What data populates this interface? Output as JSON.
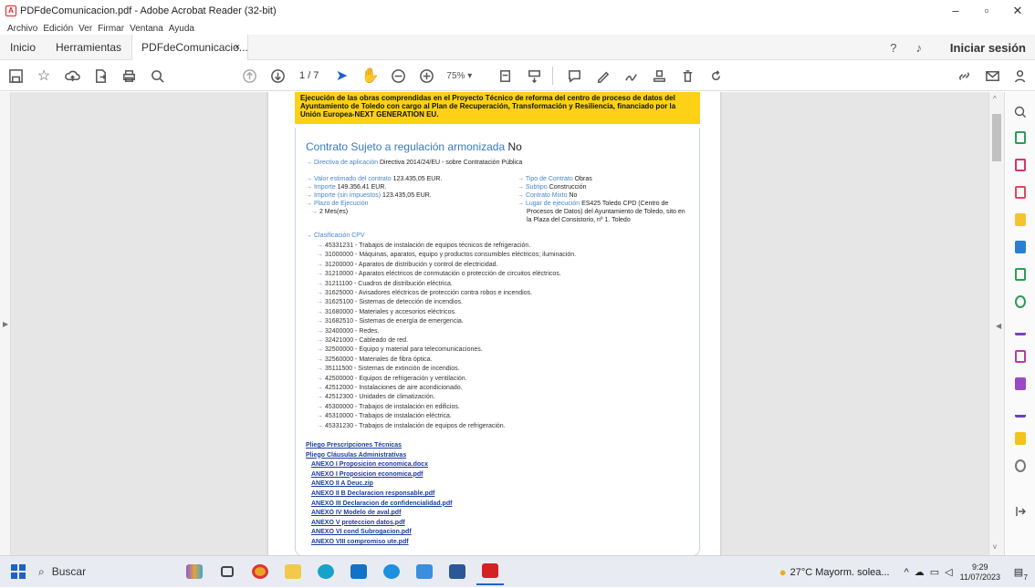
{
  "window": {
    "title": "PDFdeComunicacion.pdf - Adobe Acrobat Reader (32-bit)",
    "menu": [
      "Archivo",
      "Edición",
      "Ver",
      "Firmar",
      "Ventana",
      "Ayuda"
    ]
  },
  "tabs": {
    "home": "Inicio",
    "tools": "Herramientas",
    "doc": "PDFdeComunicacio...",
    "close": "×",
    "signin": "Iniciar sesión"
  },
  "toolbar": {
    "page_current": "1",
    "page_total": "/ 7",
    "zoom": "75%"
  },
  "document": {
    "banner": "Ejecución de las obras comprendidas en el Proyecto Técnico de reforma del centro de proceso de datos del Ayuntamiento de Toledo con cargo al Plan de Recuperación, Transformación y Resiliencia, financiado por la Unión Europea-NEXT GENERATION EU.",
    "section_title": "Contrato Sujeto a regulación armonizada",
    "section_value": "No",
    "directiva_label": "Directiva de aplicación",
    "directiva_value": "Directiva 2014/24/EU - sobre Contratación Pública",
    "valor_label": "Valor estimado del contrato",
    "valor_value": "123.435,05 EUR.",
    "importe_label": "Importe",
    "importe_value": "149.356,41 EUR.",
    "importe_sin_label": "Importe (sin impuestos)",
    "importe_sin_value": "123.435,05 EUR.",
    "plazo_label": "Plazo de Ejecución",
    "plazo_value": "2 Mes(es)",
    "tipo_label": "Tipo de Contrato",
    "tipo_value": "Obras",
    "subtipo_label": "Subtipo",
    "subtipo_value": "Construcción",
    "mixto_label": "Contrato Mixto",
    "mixto_value": "No",
    "lugar_label": "Lugar de ejecución",
    "lugar_value_1": "ES425 Toledo CPD (Centro de",
    "lugar_value_2": "Procesos de Datos) del Ayuntamiento de Toledo, sito en",
    "lugar_value_3": "la Plaza del Consistorio, nº 1. Toledo",
    "cpv_label": "Clasificación CPV",
    "cpv": [
      "45331231 - Trabajos de instalación de equipos técnicos de refrigeración.",
      "31000000 - Máquinas, aparatos, equipo y productos consumibles eléctricos; iluminación.",
      "31200000 - Aparatos de distribución y control de electricidad.",
      "31210000 - Aparatos eléctricos de conmutación o protección de circuitos eléctricos.",
      "31211100 - Cuadros de distribución eléctrica.",
      "31625000 - Avisadores eléctricos de protección contra robos e incendios.",
      "31625100 - Sistemas de detección de incendios.",
      "31680000 - Materiales y accesorios eléctricos.",
      "31682510 - Sistemas de energía de emergencia.",
      "32400000 - Redes.",
      "32421000 - Cableado de red.",
      "32500000 - Equipo y material para telecomunicaciones.",
      "32560000 - Materiales de fibra óptica.",
      "35111500 - Sistemas de extinción de incendios.",
      "42500000 - Equipos de refrigeración y ventilación.",
      "42512000 - Instalaciones de aire acondicionado.",
      "42512300 - Unidades de climatización.",
      "45300000 - Trabajos de instalación en edificios.",
      "45310000 - Trabajos de instalación eléctrica.",
      "45331230 - Trabajos de instalación de equipos de refrigeración."
    ],
    "links": [
      "Pliego Prescripciones Técnicas",
      "Pliego Cláusulas Administrativas",
      "ANEXO I Proposicion economica.docx",
      "ANEXO I Proposicion economica.pdf",
      "ANEXO II A Deuc.zip",
      "ANEXO II B Declaracion responsable.pdf",
      "ANEXO III Declaracion de confidencialidad.pdf",
      "ANEXO IV Modelo de aval.pdf",
      "ANEXO V proteccion datos.pdf",
      "ANEXO VI cond Subrogacion.pdf",
      "ANEXO VIII compromiso ute.pdf"
    ]
  },
  "taskbar": {
    "search": "Buscar",
    "weather": "27°C Mayorm. solea...",
    "time": "9:29",
    "date": "11/07/2023",
    "notif_count": "7"
  },
  "colors": {
    "banner": "#fcd116",
    "label_blue": "#4a86d0",
    "link_blue": "#1a3ea0",
    "acrobat_red": "#d22222"
  }
}
